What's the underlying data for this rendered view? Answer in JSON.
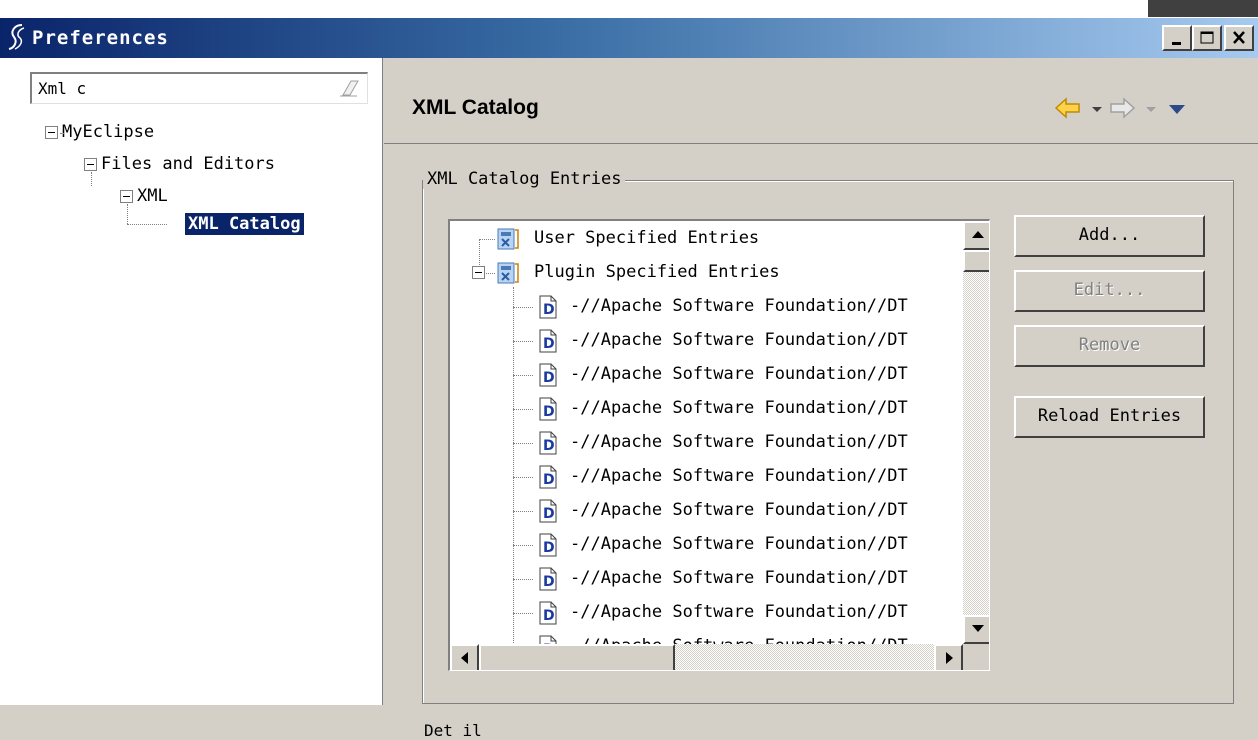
{
  "window": {
    "title": "Preferences"
  },
  "filter": {
    "value": "Xml c"
  },
  "tree": {
    "items": [
      {
        "label": "MyEclipse"
      },
      {
        "label": "Files and Editors"
      },
      {
        "label": "XML"
      },
      {
        "label": "XML Catalog"
      }
    ]
  },
  "page": {
    "title": "XML Catalog"
  },
  "catalog": {
    "group_label": "XML Catalog Entries",
    "user_entries": "User Specified Entries",
    "plugin_entries": "Plugin Specified Entries",
    "entry_text": "-//Apache Software Foundation//DT"
  },
  "buttons": {
    "add": "Add...",
    "edit": "Edit...",
    "remove": "Remove",
    "reload": "Reload Entries"
  },
  "bottom": {
    "text": "Det il"
  },
  "colors": {
    "titlebar_start": "#0a246a",
    "titlebar_end": "#a6caf0",
    "selection": "#0a246a",
    "back_arrow": "#f0b400",
    "dialog_bg": "#d4d0c8"
  },
  "icons": [
    "eclipse-logo-icon",
    "minimize-icon",
    "maximize-icon",
    "close-icon",
    "clear-filter-icon",
    "back-arrow-icon",
    "forward-arrow-icon",
    "view-menu-icon",
    "xml-catalog-icon",
    "dtd-file-icon"
  ]
}
